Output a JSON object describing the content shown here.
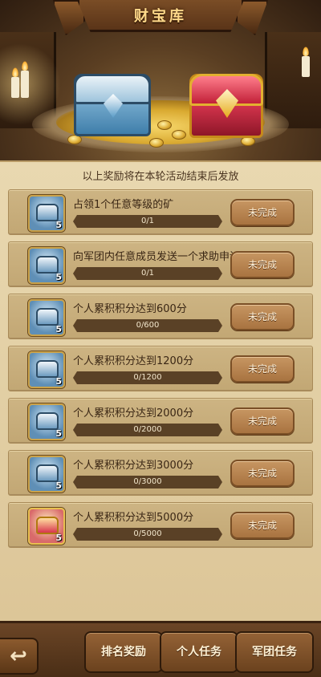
{
  "header": {
    "title": "财宝库"
  },
  "notice": "以上奖励将在本轮活动结束后发放",
  "tasks": [
    {
      "title": "占领1个任意等级的矿",
      "progress": "0/1",
      "progress_fraction": 0,
      "reward_qty": "5",
      "reward_type": "blue-chest",
      "button": "未完成"
    },
    {
      "title": "向军团内任意成员发送一个求助申请",
      "progress": "0/1",
      "progress_fraction": 0,
      "reward_qty": "5",
      "reward_type": "blue-chest",
      "button": "未完成"
    },
    {
      "title": "个人累积积分达到600分",
      "progress": "0/600",
      "progress_fraction": 0,
      "reward_qty": "5",
      "reward_type": "blue-chest",
      "button": "未完成"
    },
    {
      "title": "个人累积积分达到1200分",
      "progress": "0/1200",
      "progress_fraction": 0,
      "reward_qty": "5",
      "reward_type": "blue-chest",
      "button": "未完成"
    },
    {
      "title": "个人累积积分达到2000分",
      "progress": "0/2000",
      "progress_fraction": 0,
      "reward_qty": "5",
      "reward_type": "blue-chest",
      "button": "未完成"
    },
    {
      "title": "个人累积积分达到3000分",
      "progress": "0/3000",
      "progress_fraction": 0,
      "reward_qty": "5",
      "reward_type": "blue-chest",
      "button": "未完成"
    },
    {
      "title": "个人累积积分达到5000分",
      "progress": "0/5000",
      "progress_fraction": 0,
      "reward_qty": "5",
      "reward_type": "red-chest",
      "button": "未完成"
    }
  ],
  "bottom_nav": {
    "back_icon": "back-arrow-icon",
    "tab1": "排名奖励",
    "tab2": "个人任务",
    "tab3": "军团任务"
  }
}
